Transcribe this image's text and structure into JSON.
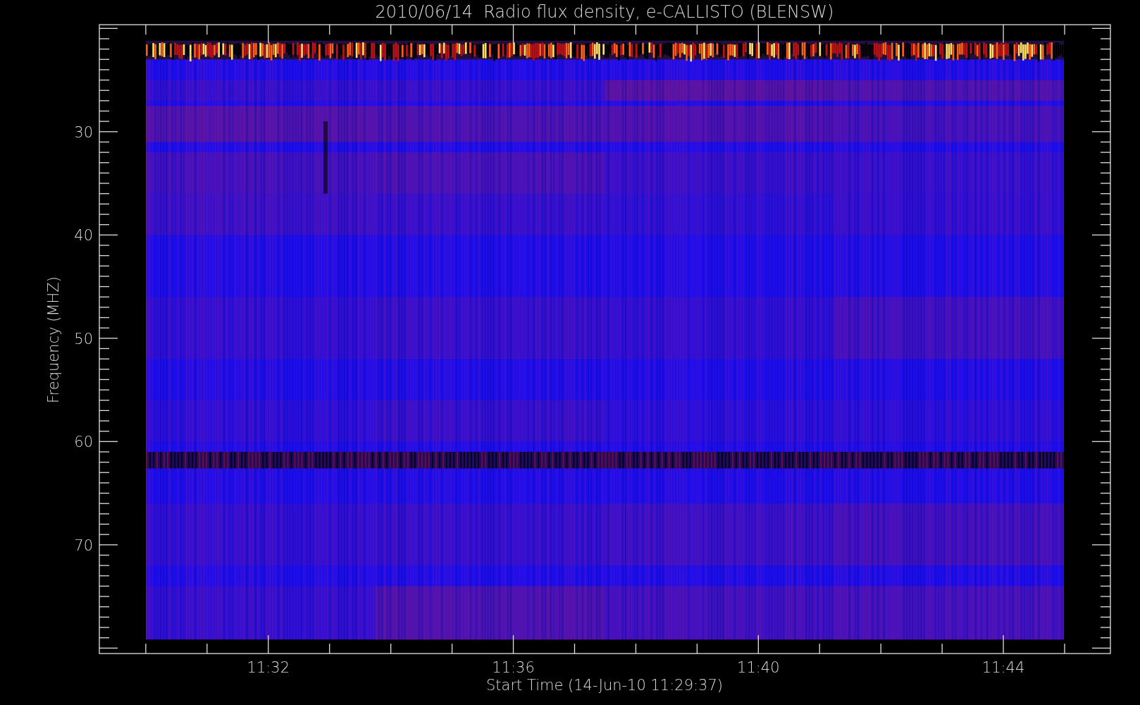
{
  "title": "2010/06/14  Radio flux density, e-CALLISTO (BLENSW)",
  "x_axis": {
    "label": "Start Time (14-Jun-10 11:29:37)",
    "ticks": [
      "11:32",
      "11:36",
      "11:40",
      "11:44"
    ]
  },
  "y_axis": {
    "label": "Frequency (MHZ)",
    "ticks": [
      "30",
      "40",
      "50",
      "60",
      "70"
    ]
  }
}
